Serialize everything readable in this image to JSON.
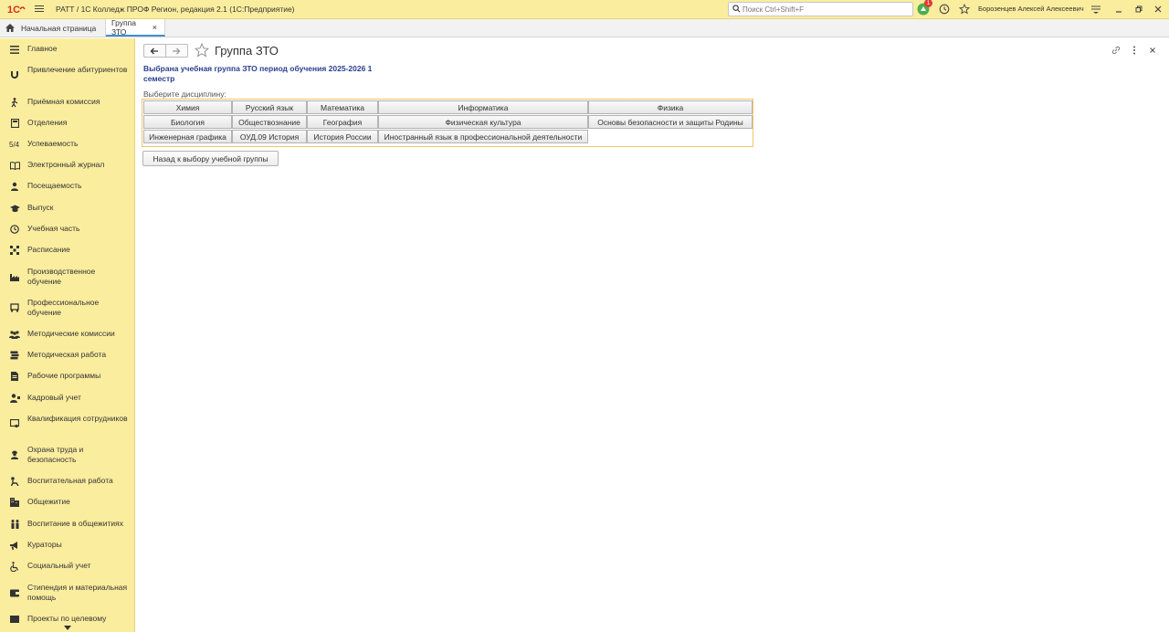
{
  "titlebar": {
    "title": "РАТТ / 1С Колледж ПРОФ Регион, редакция 2.1  (1С:Предприятие)",
    "search_placeholder": "Поиск Ctrl+Shift+F",
    "notification_count": "1",
    "user": "Борозенцев Алексей Алексеевич"
  },
  "tabs": {
    "home": "Начальная страница",
    "active": "Группа ЗТО"
  },
  "sidebar": {
    "items": [
      {
        "label": "Главное",
        "icon": "list-icon"
      },
      {
        "label": "Привлечение абитуриентов",
        "icon": "magnet-icon"
      },
      {
        "label": "Приёмная комиссия",
        "icon": "walker-icon"
      },
      {
        "label": "Отделения",
        "icon": "door-icon"
      },
      {
        "label": "Успеваемость",
        "icon": "grade-icon"
      },
      {
        "label": "Электронный журнал",
        "icon": "book-icon"
      },
      {
        "label": "Посещаемость",
        "icon": "person-icon"
      },
      {
        "label": "Выпуск",
        "icon": "graduation-cap-icon"
      },
      {
        "label": "Учебная часть",
        "icon": "clock-icon"
      },
      {
        "label": "Расписание",
        "icon": "schedule-icon"
      },
      {
        "label": "Производственное обучение",
        "icon": "factory-icon"
      },
      {
        "label": "Профессиональное обучение",
        "icon": "monitor-icon"
      },
      {
        "label": "Методические комиссии",
        "icon": "group-icon"
      },
      {
        "label": "Методическая работа",
        "icon": "books-icon"
      },
      {
        "label": "Рабочие программы",
        "icon": "document-icon"
      },
      {
        "label": "Кадровый учет",
        "icon": "staff-icon"
      },
      {
        "label": "Квалификация сотрудников",
        "icon": "certificate-icon"
      },
      {
        "label": "Охрана труда и безопасность",
        "icon": "worker-icon"
      },
      {
        "label": "Воспитательная работа",
        "icon": "child-icon"
      },
      {
        "label": "Общежитие",
        "icon": "building-icon"
      },
      {
        "label": "Воспитание в общежитиях",
        "icon": "people-icon"
      },
      {
        "label": "Кураторы",
        "icon": "megaphone-icon"
      },
      {
        "label": "Социальный учет",
        "icon": "wheelchair-icon"
      },
      {
        "label": "Стипендия и материальная помощь",
        "icon": "wallet-icon"
      },
      {
        "label": "Проекты по целевому",
        "icon": "project-icon"
      }
    ]
  },
  "page": {
    "title": "Группа ЗТО",
    "group_info": "Выбрана учебная группа ЗТО период обучения 2025-2026 1 семестр",
    "choose_label": "Выберите дисциплину:",
    "back_button": "Назад к выбору учебной группы"
  },
  "disciplines": [
    [
      "Химия",
      "Русский язык",
      "Математика",
      "Информатика",
      "Физика"
    ],
    [
      "Биология",
      "Обществознание",
      "География",
      "Физическая культура",
      "Основы безопасности и защиты Родины"
    ],
    [
      "Инженерная графика",
      "ОУД.09 История",
      "История России",
      "Иностранный язык в профессиональной деятельности"
    ]
  ],
  "colors": {
    "sidebar_bg": "#fbed9e",
    "group_info_text": "#2a3d8f",
    "frame_border": "#f2c46b",
    "active_tab_underline": "#3f8fd2"
  }
}
